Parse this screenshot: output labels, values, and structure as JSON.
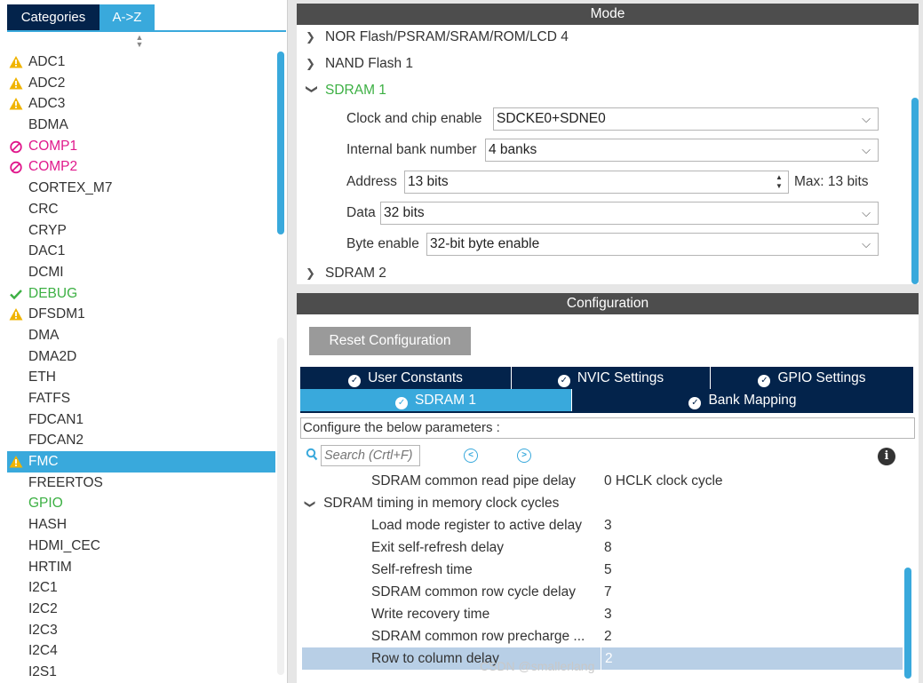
{
  "left": {
    "tabs": [
      "Categories",
      "A->Z"
    ],
    "items": [
      {
        "label": "ADC1",
        "status": "warning"
      },
      {
        "label": "ADC2",
        "status": "warning"
      },
      {
        "label": "ADC3",
        "status": "warning"
      },
      {
        "label": "BDMA",
        "status": "none"
      },
      {
        "label": "COMP1",
        "status": "disabled"
      },
      {
        "label": "COMP2",
        "status": "disabled"
      },
      {
        "label": "CORTEX_M7",
        "status": "none"
      },
      {
        "label": "CRC",
        "status": "none"
      },
      {
        "label": "CRYP",
        "status": "none"
      },
      {
        "label": "DAC1",
        "status": "none"
      },
      {
        "label": "DCMI",
        "status": "none"
      },
      {
        "label": "DEBUG",
        "status": "enabled"
      },
      {
        "label": "DFSDM1",
        "status": "warning"
      },
      {
        "label": "DMA",
        "status": "none"
      },
      {
        "label": "DMA2D",
        "status": "none"
      },
      {
        "label": "ETH",
        "status": "none"
      },
      {
        "label": "FATFS",
        "status": "none"
      },
      {
        "label": "FDCAN1",
        "status": "none"
      },
      {
        "label": "FDCAN2",
        "status": "none"
      },
      {
        "label": "FMC",
        "status": "warning",
        "selected": true
      },
      {
        "label": "FREERTOS",
        "status": "none"
      },
      {
        "label": "GPIO",
        "status": "enabled-text"
      },
      {
        "label": "HASH",
        "status": "none"
      },
      {
        "label": "HDMI_CEC",
        "status": "none"
      },
      {
        "label": "HRTIM",
        "status": "none"
      },
      {
        "label": "I2C1",
        "status": "none"
      },
      {
        "label": "I2C2",
        "status": "none"
      },
      {
        "label": "I2C3",
        "status": "none"
      },
      {
        "label": "I2C4",
        "status": "none"
      },
      {
        "label": "I2S1",
        "status": "none"
      }
    ]
  },
  "mode": {
    "header": "Mode",
    "tree": [
      {
        "label": "NOR Flash/PSRAM/SRAM/ROM/LCD 4",
        "expanded": false
      },
      {
        "label": "NAND Flash 1",
        "expanded": false
      },
      {
        "label": "SDRAM 1",
        "expanded": true
      },
      {
        "label": "SDRAM 2",
        "expanded": false
      }
    ],
    "fields": {
      "clock_label": "Clock and chip enable",
      "clock_value": "SDCKE0+SDNE0",
      "bank_label": "Internal bank number",
      "bank_value": "4 banks",
      "address_label": "Address",
      "address_value": "13 bits",
      "address_max": "Max: 13 bits",
      "data_label": "Data",
      "data_value": "32 bits",
      "byte_label": "Byte enable",
      "byte_value": "32-bit byte enable"
    }
  },
  "config": {
    "header": "Configuration",
    "reset_label": "Reset Configuration",
    "tabs_row1": [
      "User Constants",
      "NVIC Settings",
      "GPIO Settings"
    ],
    "tabs_row2": [
      "SDRAM 1",
      "Bank Mapping"
    ],
    "params_title": "Configure the below parameters :",
    "search_placeholder": "Search (Crtl+F)",
    "params": [
      {
        "name": "SDRAM common read pipe delay",
        "value": "0 HCLK clock cycle",
        "group": false
      },
      {
        "name": "SDRAM timing in memory clock cycles",
        "value": "",
        "group": true
      },
      {
        "name": "Load mode register to active delay",
        "value": "3",
        "group": false
      },
      {
        "name": "Exit self-refresh delay",
        "value": "8",
        "group": false
      },
      {
        "name": "Self-refresh time",
        "value": "5",
        "group": false
      },
      {
        "name": "SDRAM common row cycle delay",
        "value": "7",
        "group": false
      },
      {
        "name": "Write recovery time",
        "value": "3",
        "group": false
      },
      {
        "name": "SDRAM common row precharge ...",
        "value": "2",
        "group": false
      },
      {
        "name": "Row to column delay",
        "value": "2",
        "group": false,
        "selected": true
      }
    ]
  },
  "watermark": "CSDN @smallerlang",
  "colors": {
    "navy": "#03234b",
    "accent_blue": "#39a9dc",
    "header_gray": "#4d4d4d",
    "warning": "#f0b400",
    "disabled": "#e0198c",
    "enabled": "#3cb043"
  }
}
